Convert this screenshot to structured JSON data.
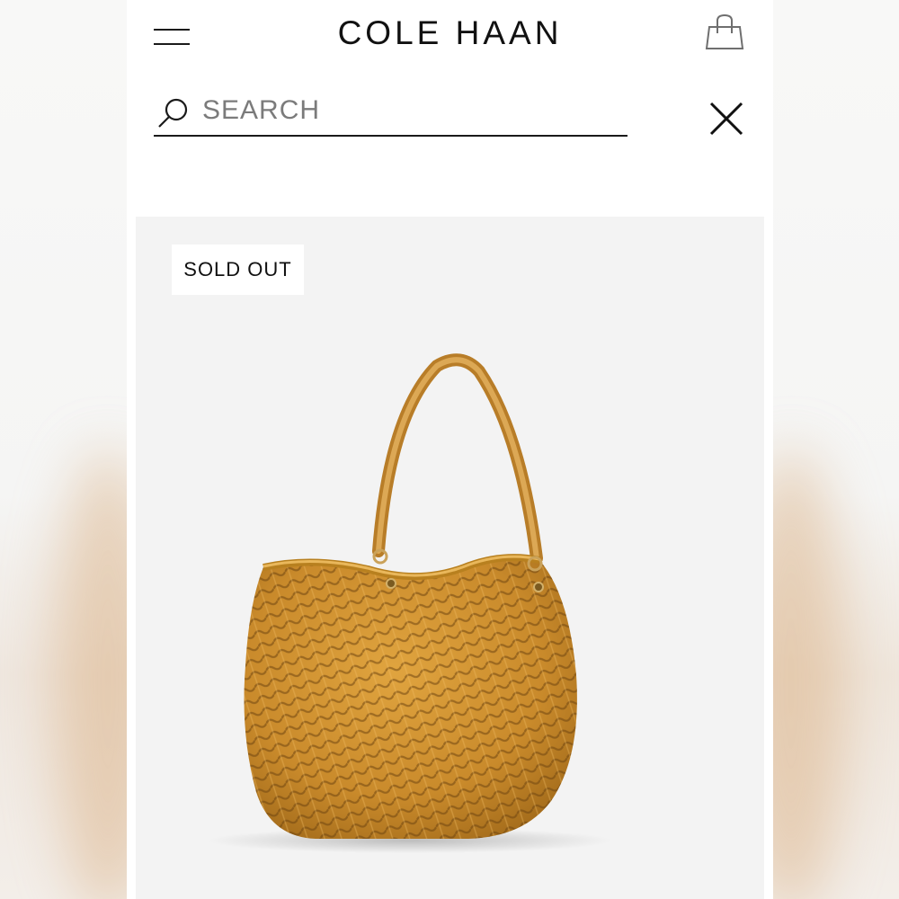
{
  "header": {
    "brand": "COLE HAAN",
    "menu_icon": "hamburger-menu-icon",
    "bag_icon": "shopping-bag-icon"
  },
  "search": {
    "placeholder": "SEARCH",
    "value": "",
    "search_icon": "search-icon",
    "close_icon": "close-icon"
  },
  "product": {
    "badge": "SOLD OUT",
    "image": "woven-leather-tote-bag",
    "color": "#c98a2b"
  }
}
